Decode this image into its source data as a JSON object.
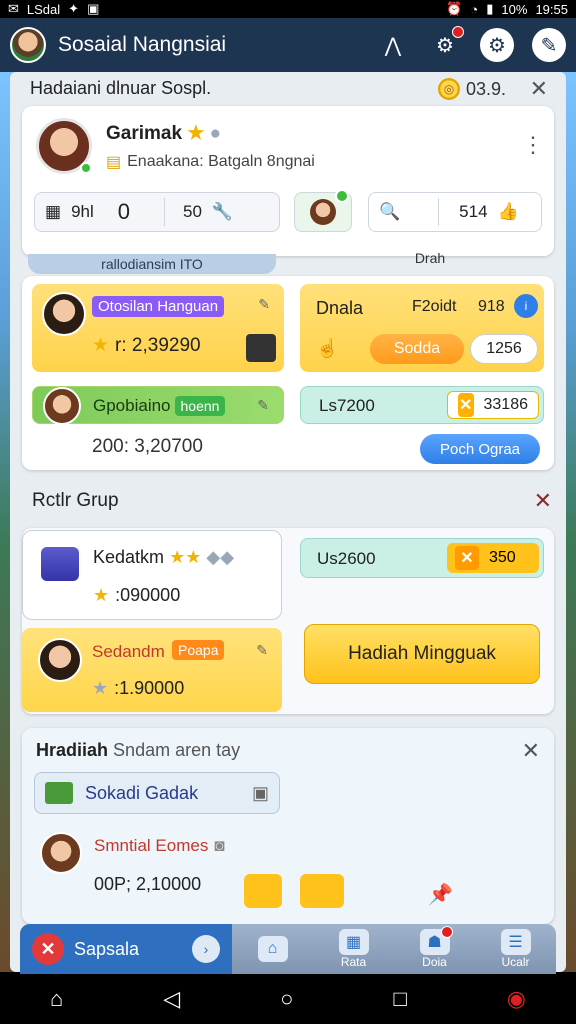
{
  "status_bar": {
    "carrier": "LSdal",
    "battery": "10%",
    "time": "19:55"
  },
  "app_bar": {
    "title": "Sosaial Nangnsiai"
  },
  "sheet": {
    "header": {
      "title": "Hadaiani dlnuar Sospl.",
      "balance": "03.9."
    },
    "profile": {
      "name": "Garimak",
      "subtitle": "Enaakana: Batgaln 8ngnai",
      "stat_label": "9hl",
      "stat_value": "0",
      "stat_value2": "50",
      "search_value": "514"
    },
    "tab_left": "rallodiansim ITO",
    "tab_right": "Drah",
    "leaderboard": {
      "row1": {
        "name": "Otosilan Hanguan",
        "score": "r: 2,39290"
      },
      "row2_name": "Gpobiaino",
      "row2_badge": "hoenn",
      "row2_score": "200: 3,20700",
      "right1": {
        "title": "Dnala",
        "sub": "F2oidt",
        "count": "918",
        "button_orange": "Sodda",
        "button_white": "1256"
      },
      "right2": {
        "label": "Ls7200",
        "value": "33186"
      },
      "button_blue": "Poch Ograa"
    },
    "section2": {
      "title": "Rctlr Grup",
      "card1": {
        "name": "Kedatkm",
        "score": ":090000"
      },
      "card2": {
        "name": "Sedandm",
        "badge": "Poapa",
        "score": ":1.90000"
      },
      "mint": {
        "label": "Us2600",
        "value": "350"
      },
      "big_button": "Hadiah Mingguak"
    },
    "section3": {
      "title_bold": "Hradiiah",
      "title_rest": "Sndam aren tay",
      "chip": "Sokadi Gadak",
      "player": "Smntial Eomes",
      "score": "00P; 2,10000"
    }
  },
  "bottom_nav": {
    "left_label": "Sapsala",
    "items": [
      "",
      "Rata",
      "Doia",
      "Ucalr"
    ]
  }
}
